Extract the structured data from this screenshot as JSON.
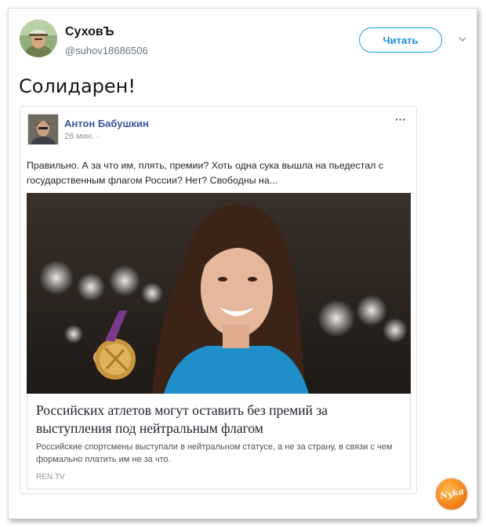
{
  "tweet": {
    "display_name": "СуховЪ",
    "handle": "@suhov18686506",
    "follow_label": "Читать",
    "text": "Солидарен!"
  },
  "embedded_post": {
    "author": "Антон Бабушкин",
    "time": "26 мин. ·",
    "menu": "···",
    "text": "Правильно. А за что им, плять, премии? Хоть одна сука вышла на пьедестал с государственным флагом России? Нет? Свободны на...",
    "link": {
      "title": "Российских атлетов могут оставить без премий за выступления под нейтральным флагом",
      "description": "Российские спортсмены выступали в нейтральном статусе, а не за страну, в связи с чем формально платить им не за что.",
      "source": "REN.TV"
    }
  },
  "watermark": {
    "text": "Nyka"
  },
  "colors": {
    "follow_blue": "#1da1f2",
    "fb_name_blue": "#365899",
    "watermark_orange": "#f07a14"
  }
}
